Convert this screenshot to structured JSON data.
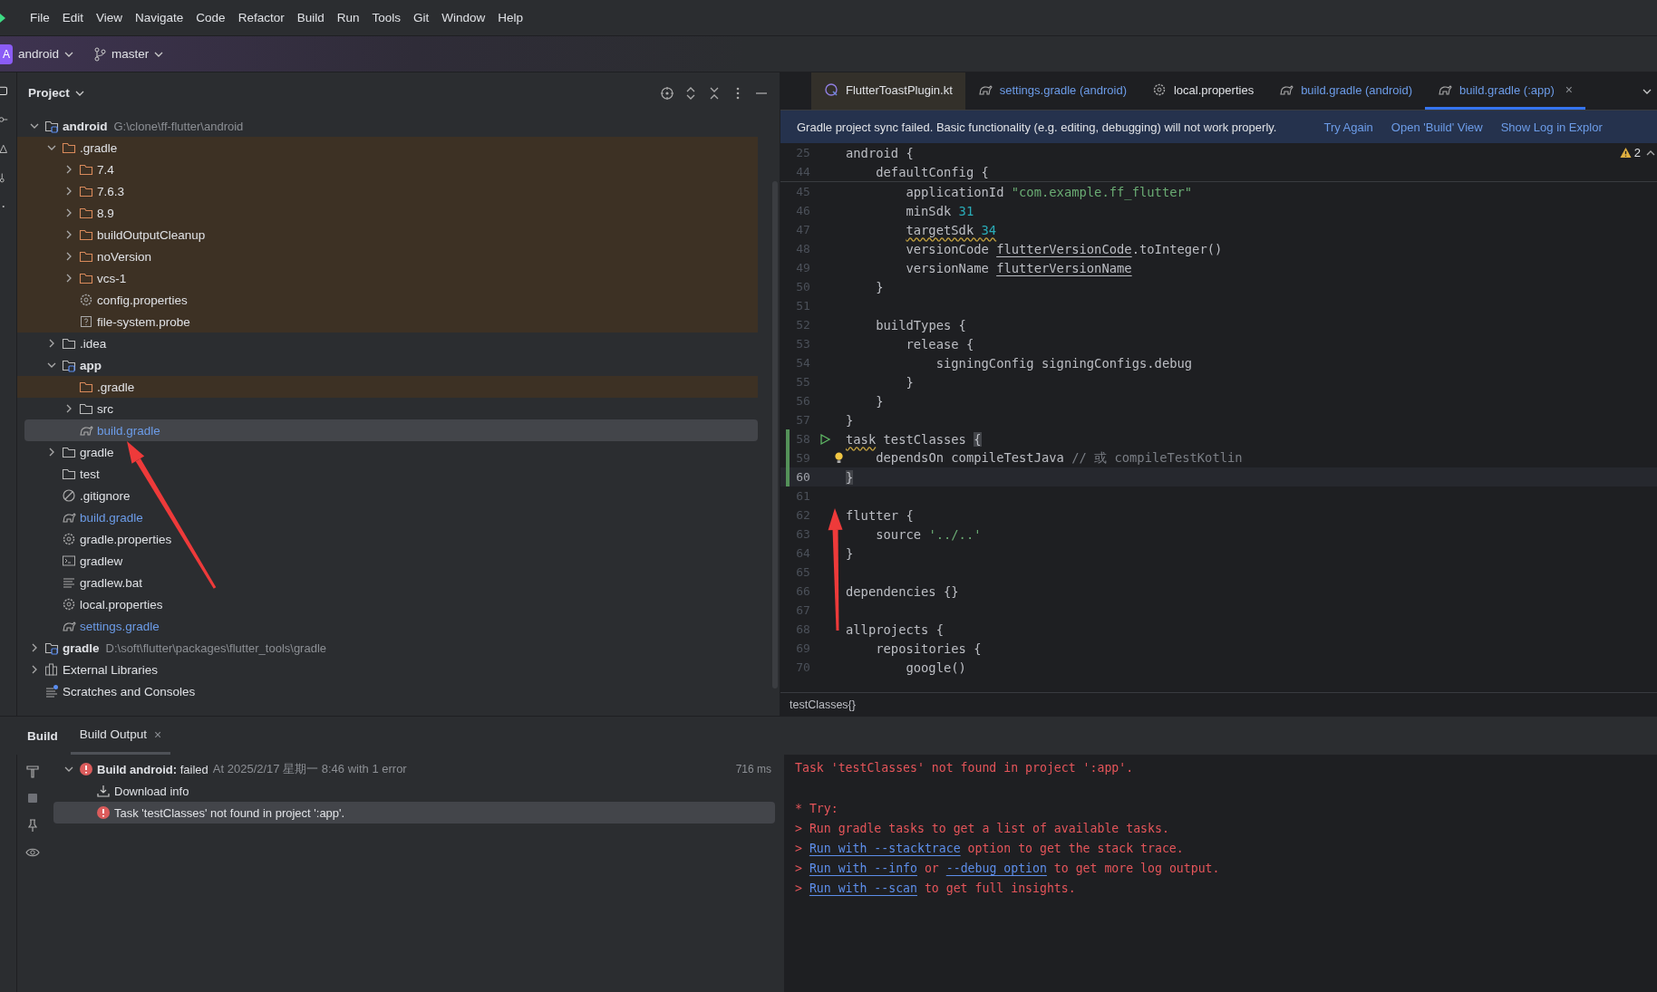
{
  "menu": [
    "File",
    "Edit",
    "View",
    "Navigate",
    "Code",
    "Refactor",
    "Build",
    "Run",
    "Tools",
    "Git",
    "Window",
    "Help"
  ],
  "toolbar": {
    "project_badge": "A",
    "project": "android",
    "branch": "master"
  },
  "project_panel": {
    "title": "Project"
  },
  "project_tree": [
    {
      "name": "android",
      "path": "G:\\clone\\ff-flutter\\android",
      "kind": "module",
      "expanded": true,
      "selected": false,
      "excluded": false,
      "modified": false,
      "children": [
        {
          "name": ".gradle",
          "kind": "folder",
          "expanded": true,
          "selected": false,
          "excluded": true,
          "modified": false,
          "children": [
            {
              "name": "7.4",
              "kind": "folder",
              "expanded": false,
              "selected": false,
              "excluded": true,
              "modified": false
            },
            {
              "name": "7.6.3",
              "kind": "folder",
              "expanded": false,
              "selected": false,
              "excluded": true,
              "modified": false
            },
            {
              "name": "8.9",
              "kind": "folder",
              "expanded": false,
              "selected": false,
              "excluded": true,
              "modified": false
            },
            {
              "name": "buildOutputCleanup",
              "kind": "folder",
              "expanded": false,
              "selected": false,
              "excluded": true,
              "modified": false
            },
            {
              "name": "noVersion",
              "kind": "folder",
              "expanded": false,
              "selected": false,
              "excluded": true,
              "modified": false
            },
            {
              "name": "vcs-1",
              "kind": "folder",
              "expanded": false,
              "selected": false,
              "excluded": true,
              "modified": false
            },
            {
              "name": "config.properties",
              "kind": "gear",
              "selected": false,
              "excluded": true,
              "modified": false
            },
            {
              "name": "file-system.probe",
              "kind": "unknown",
              "selected": false,
              "excluded": true,
              "modified": false
            }
          ]
        },
        {
          "name": ".idea",
          "kind": "folder",
          "expanded": false,
          "selected": false,
          "excluded": false,
          "modified": false
        },
        {
          "name": "app",
          "kind": "module",
          "expanded": true,
          "selected": false,
          "excluded": false,
          "modified": false,
          "children": [
            {
              "name": ".gradle",
              "kind": "folder",
              "selected": false,
              "excluded": true,
              "modified": false
            },
            {
              "name": "src",
              "kind": "folder",
              "expanded": false,
              "selected": false,
              "excluded": false,
              "modified": false
            },
            {
              "name": "build.gradle",
              "kind": "gradle",
              "selected": true,
              "excluded": false,
              "modified": true
            }
          ]
        },
        {
          "name": "gradle",
          "kind": "folder",
          "expanded": false,
          "selected": false,
          "excluded": false,
          "modified": false
        },
        {
          "name": "test",
          "kind": "folder",
          "selected": false,
          "excluded": false,
          "modified": false
        },
        {
          "name": ".gitignore",
          "kind": "ignore",
          "selected": false,
          "excluded": false,
          "modified": false
        },
        {
          "name": "build.gradle",
          "kind": "gradle",
          "selected": false,
          "excluded": false,
          "modified": true
        },
        {
          "name": "gradle.properties",
          "kind": "gear",
          "selected": false,
          "excluded": false,
          "modified": false
        },
        {
          "name": "gradlew",
          "kind": "terminal",
          "selected": false,
          "excluded": false,
          "modified": false
        },
        {
          "name": "gradlew.bat",
          "kind": "lines",
          "selected": false,
          "excluded": false,
          "modified": false
        },
        {
          "name": "local.properties",
          "kind": "gear",
          "selected": false,
          "excluded": false,
          "modified": false
        },
        {
          "name": "settings.gradle",
          "kind": "gradle",
          "selected": false,
          "excluded": false,
          "modified": true
        }
      ]
    },
    {
      "name": "gradle",
      "path": "D:\\soft\\flutter\\packages\\flutter_tools\\gradle",
      "kind": "module",
      "expanded": false,
      "selected": false,
      "excluded": false,
      "modified": false
    },
    {
      "name": "External Libraries",
      "kind": "library",
      "expanded": false,
      "selected": false,
      "excluded": false,
      "modified": false
    },
    {
      "name": "Scratches and Consoles",
      "kind": "scratch",
      "selected": false,
      "excluded": false,
      "modified": false
    }
  ],
  "editor_tabs": [
    {
      "label": "FlutterToastPlugin.kt",
      "kind": "kotlin",
      "selected": false,
      "modified": false,
      "external": true
    },
    {
      "label": "settings.gradle (android)",
      "kind": "gradle",
      "selected": false,
      "modified": true,
      "external": false
    },
    {
      "label": "local.properties",
      "kind": "gear",
      "selected": false,
      "modified": false,
      "external": false
    },
    {
      "label": "build.gradle (android)",
      "kind": "gradle",
      "selected": false,
      "modified": true,
      "external": false
    },
    {
      "label": "build.gradle (:app)",
      "kind": "gradle",
      "selected": true,
      "modified": true,
      "external": false,
      "close": "×"
    }
  ],
  "banner": {
    "message": "Gradle project sync failed. Basic functionality (e.g. editing, debugging) will not work properly.",
    "actions": [
      "Try Again",
      "Open 'Build' View",
      "Show Log in Explor"
    ]
  },
  "warnings": "2",
  "sticky_lines": [
    {
      "num": "25",
      "tokens": [
        {
          "t": "android {",
          "kind": "plain"
        }
      ]
    },
    {
      "num": "44",
      "tokens": [
        {
          "t": "    defaultConfig {",
          "kind": "plain"
        }
      ]
    }
  ],
  "lines": [
    {
      "num": "45",
      "kind": "code",
      "changed": false,
      "current": false,
      "tokens": [
        {
          "t": "        applicationId ",
          "kind": "plain"
        },
        {
          "t": "\"com.example.ff_flutter\"",
          "kind": "str"
        }
      ]
    },
    {
      "num": "46",
      "kind": "code",
      "changed": false,
      "current": false,
      "tokens": [
        {
          "t": "        minSdk ",
          "kind": "plain"
        },
        {
          "t": "31",
          "kind": "num"
        }
      ]
    },
    {
      "num": "47",
      "kind": "code",
      "changed": false,
      "current": false,
      "tokens": [
        {
          "t": "        targetSdk ",
          "kind": "warn"
        },
        {
          "t": "34",
          "kind": "warnnum"
        }
      ]
    },
    {
      "num": "48",
      "kind": "code",
      "changed": false,
      "current": false,
      "tokens": [
        {
          "t": "        versionCode ",
          "kind": "plain"
        },
        {
          "t": "flutterVersionCode",
          "kind": "ref"
        },
        {
          "t": ".toInteger()",
          "kind": "plain"
        }
      ]
    },
    {
      "num": "49",
      "kind": "code",
      "changed": false,
      "current": false,
      "tokens": [
        {
          "t": "        versionName ",
          "kind": "plain"
        },
        {
          "t": "flutterVersionName",
          "kind": "ref"
        }
      ]
    },
    {
      "num": "50",
      "kind": "code",
      "changed": false,
      "current": false,
      "tokens": [
        {
          "t": "    }",
          "kind": "plain"
        }
      ]
    },
    {
      "num": "51",
      "kind": "code",
      "changed": false,
      "current": false
    },
    {
      "num": "52",
      "kind": "code",
      "changed": false,
      "current": false,
      "tokens": [
        {
          "t": "    buildTypes {",
          "kind": "plain"
        }
      ]
    },
    {
      "num": "53",
      "kind": "code",
      "changed": false,
      "current": false,
      "tokens": [
        {
          "t": "        release {",
          "kind": "plain"
        }
      ]
    },
    {
      "num": "54",
      "kind": "code",
      "changed": false,
      "current": false,
      "tokens": [
        {
          "t": "            signingConfig signingConfigs.debug",
          "kind": "plain"
        }
      ]
    },
    {
      "num": "55",
      "kind": "code",
      "changed": false,
      "current": false,
      "tokens": [
        {
          "t": "        }",
          "kind": "plain"
        }
      ]
    },
    {
      "num": "56",
      "kind": "code",
      "changed": false,
      "current": false,
      "tokens": [
        {
          "t": "    }",
          "kind": "plain"
        }
      ]
    },
    {
      "num": "57",
      "kind": "code",
      "changed": false,
      "current": false,
      "tokens": [
        {
          "t": "}",
          "kind": "plain"
        }
      ]
    },
    {
      "num": "58",
      "kind": "run",
      "changed": true,
      "current": false,
      "tokens": [
        {
          "t": "task",
          "kind": "warn"
        },
        {
          "t": " testClasses ",
          "kind": "plain"
        },
        {
          "t": "{",
          "kind": "match"
        }
      ]
    },
    {
      "num": "59",
      "kind": "bulb",
      "changed": true,
      "current": false,
      "tokens": [
        {
          "t": "    dependsOn compileTestJava ",
          "kind": "plain"
        },
        {
          "t": "// 或 compileTestKotlin",
          "kind": "comment"
        }
      ]
    },
    {
      "num": "60",
      "kind": "code",
      "changed": true,
      "current": true,
      "tokens": [
        {
          "t": "}",
          "kind": "match"
        }
      ]
    },
    {
      "num": "61",
      "kind": "code",
      "changed": false,
      "current": false
    },
    {
      "num": "62",
      "kind": "code",
      "changed": false,
      "current": false,
      "tokens": [
        {
          "t": "flutter {",
          "kind": "plain"
        }
      ]
    },
    {
      "num": "63",
      "kind": "code",
      "changed": false,
      "current": false,
      "tokens": [
        {
          "t": "    source ",
          "kind": "plain"
        },
        {
          "t": "'../..'",
          "kind": "str"
        }
      ]
    },
    {
      "num": "64",
      "kind": "code",
      "changed": false,
      "current": false,
      "tokens": [
        {
          "t": "}",
          "kind": "plain"
        }
      ]
    },
    {
      "num": "65",
      "kind": "code",
      "changed": false,
      "current": false
    },
    {
      "num": "66",
      "kind": "code",
      "changed": false,
      "current": false,
      "tokens": [
        {
          "t": "dependencies {}",
          "kind": "plain"
        }
      ]
    },
    {
      "num": "67",
      "kind": "code",
      "changed": false,
      "current": false
    },
    {
      "num": "68",
      "kind": "code",
      "changed": false,
      "current": false,
      "tokens": [
        {
          "t": "allprojects {",
          "kind": "plain"
        }
      ]
    },
    {
      "num": "69",
      "kind": "code",
      "changed": false,
      "current": false,
      "tokens": [
        {
          "t": "    repositories {",
          "kind": "plain"
        }
      ]
    },
    {
      "num": "70",
      "kind": "code",
      "changed": false,
      "current": false,
      "tokens": [
        {
          "t": "        google()",
          "kind": "plain"
        }
      ]
    }
  ],
  "breadcrumb": "testClasses{}",
  "build_panel": {
    "title": "Build",
    "tabs": [
      {
        "label": "Build Output",
        "selected": true,
        "close": "×"
      }
    ]
  },
  "build_tree": [
    {
      "label": "Build android:",
      "status": "failed",
      "detail": "At 2025/2/17 星期一 8:46 with 1 error",
      "time": "716 ms",
      "kind": "error",
      "expanded": true,
      "selected": false,
      "children": [
        {
          "label": "Download info",
          "kind": "download",
          "selected": false
        },
        {
          "label": "Task 'testClasses' not found in project ':app'.",
          "kind": "error",
          "selected": true
        }
      ]
    }
  ],
  "output": [
    {
      "kind": "message",
      "segments": [
        {
          "t": "Task 'testClasses' not found in project ':app'.",
          "kind": "text"
        }
      ]
    },
    {
      "kind": "hint",
      "segments": [
        {
          "t": "* Try:",
          "kind": "text"
        }
      ]
    },
    {
      "kind": "hint",
      "segments": [
        {
          "t": "> Run gradle tasks to get a list of available tasks.",
          "kind": "text"
        }
      ]
    },
    {
      "kind": "hint",
      "segments": [
        {
          "t": "> ",
          "kind": "text"
        },
        {
          "t": "Run with --stacktrace",
          "kind": "link"
        },
        {
          "t": " option to get the stack trace.",
          "kind": "text"
        }
      ]
    },
    {
      "kind": "hint",
      "segments": [
        {
          "t": "> ",
          "kind": "text"
        },
        {
          "t": "Run with --info",
          "kind": "link"
        },
        {
          "t": " or ",
          "kind": "text"
        },
        {
          "t": "--debug option",
          "kind": "link"
        },
        {
          "t": " to get more log output.",
          "kind": "text"
        }
      ]
    },
    {
      "kind": "hint",
      "segments": [
        {
          "t": "> ",
          "kind": "text"
        },
        {
          "t": "Run with --scan",
          "kind": "link"
        },
        {
          "t": " to get full insights.",
          "kind": "text"
        }
      ]
    }
  ],
  "annotations": [
    {
      "kind": "arrow"
    },
    {
      "kind": "arrow"
    }
  ]
}
